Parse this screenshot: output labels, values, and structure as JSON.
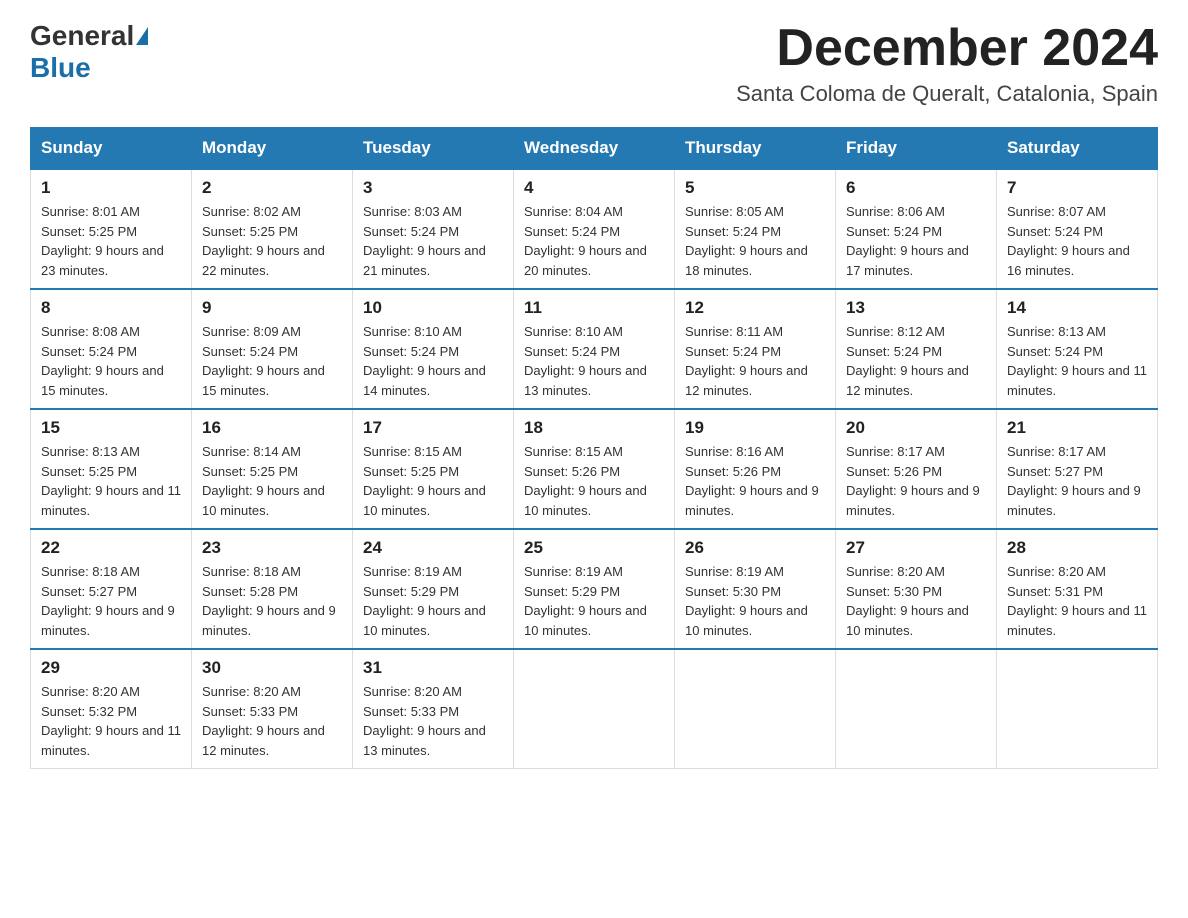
{
  "logo": {
    "general": "General",
    "blue": "Blue"
  },
  "title": {
    "month": "December 2024",
    "location": "Santa Coloma de Queralt, Catalonia, Spain"
  },
  "days_of_week": [
    "Sunday",
    "Monday",
    "Tuesday",
    "Wednesday",
    "Thursday",
    "Friday",
    "Saturday"
  ],
  "weeks": [
    [
      {
        "day": 1,
        "sunrise": "8:01 AM",
        "sunset": "5:25 PM",
        "daylight": "9 hours and 23 minutes."
      },
      {
        "day": 2,
        "sunrise": "8:02 AM",
        "sunset": "5:25 PM",
        "daylight": "9 hours and 22 minutes."
      },
      {
        "day": 3,
        "sunrise": "8:03 AM",
        "sunset": "5:24 PM",
        "daylight": "9 hours and 21 minutes."
      },
      {
        "day": 4,
        "sunrise": "8:04 AM",
        "sunset": "5:24 PM",
        "daylight": "9 hours and 20 minutes."
      },
      {
        "day": 5,
        "sunrise": "8:05 AM",
        "sunset": "5:24 PM",
        "daylight": "9 hours and 18 minutes."
      },
      {
        "day": 6,
        "sunrise": "8:06 AM",
        "sunset": "5:24 PM",
        "daylight": "9 hours and 17 minutes."
      },
      {
        "day": 7,
        "sunrise": "8:07 AM",
        "sunset": "5:24 PM",
        "daylight": "9 hours and 16 minutes."
      }
    ],
    [
      {
        "day": 8,
        "sunrise": "8:08 AM",
        "sunset": "5:24 PM",
        "daylight": "9 hours and 15 minutes."
      },
      {
        "day": 9,
        "sunrise": "8:09 AM",
        "sunset": "5:24 PM",
        "daylight": "9 hours and 15 minutes."
      },
      {
        "day": 10,
        "sunrise": "8:10 AM",
        "sunset": "5:24 PM",
        "daylight": "9 hours and 14 minutes."
      },
      {
        "day": 11,
        "sunrise": "8:10 AM",
        "sunset": "5:24 PM",
        "daylight": "9 hours and 13 minutes."
      },
      {
        "day": 12,
        "sunrise": "8:11 AM",
        "sunset": "5:24 PM",
        "daylight": "9 hours and 12 minutes."
      },
      {
        "day": 13,
        "sunrise": "8:12 AM",
        "sunset": "5:24 PM",
        "daylight": "9 hours and 12 minutes."
      },
      {
        "day": 14,
        "sunrise": "8:13 AM",
        "sunset": "5:24 PM",
        "daylight": "9 hours and 11 minutes."
      }
    ],
    [
      {
        "day": 15,
        "sunrise": "8:13 AM",
        "sunset": "5:25 PM",
        "daylight": "9 hours and 11 minutes."
      },
      {
        "day": 16,
        "sunrise": "8:14 AM",
        "sunset": "5:25 PM",
        "daylight": "9 hours and 10 minutes."
      },
      {
        "day": 17,
        "sunrise": "8:15 AM",
        "sunset": "5:25 PM",
        "daylight": "9 hours and 10 minutes."
      },
      {
        "day": 18,
        "sunrise": "8:15 AM",
        "sunset": "5:26 PM",
        "daylight": "9 hours and 10 minutes."
      },
      {
        "day": 19,
        "sunrise": "8:16 AM",
        "sunset": "5:26 PM",
        "daylight": "9 hours and 9 minutes."
      },
      {
        "day": 20,
        "sunrise": "8:17 AM",
        "sunset": "5:26 PM",
        "daylight": "9 hours and 9 minutes."
      },
      {
        "day": 21,
        "sunrise": "8:17 AM",
        "sunset": "5:27 PM",
        "daylight": "9 hours and 9 minutes."
      }
    ],
    [
      {
        "day": 22,
        "sunrise": "8:18 AM",
        "sunset": "5:27 PM",
        "daylight": "9 hours and 9 minutes."
      },
      {
        "day": 23,
        "sunrise": "8:18 AM",
        "sunset": "5:28 PM",
        "daylight": "9 hours and 9 minutes."
      },
      {
        "day": 24,
        "sunrise": "8:19 AM",
        "sunset": "5:29 PM",
        "daylight": "9 hours and 10 minutes."
      },
      {
        "day": 25,
        "sunrise": "8:19 AM",
        "sunset": "5:29 PM",
        "daylight": "9 hours and 10 minutes."
      },
      {
        "day": 26,
        "sunrise": "8:19 AM",
        "sunset": "5:30 PM",
        "daylight": "9 hours and 10 minutes."
      },
      {
        "day": 27,
        "sunrise": "8:20 AM",
        "sunset": "5:30 PM",
        "daylight": "9 hours and 10 minutes."
      },
      {
        "day": 28,
        "sunrise": "8:20 AM",
        "sunset": "5:31 PM",
        "daylight": "9 hours and 11 minutes."
      }
    ],
    [
      {
        "day": 29,
        "sunrise": "8:20 AM",
        "sunset": "5:32 PM",
        "daylight": "9 hours and 11 minutes."
      },
      {
        "day": 30,
        "sunrise": "8:20 AM",
        "sunset": "5:33 PM",
        "daylight": "9 hours and 12 minutes."
      },
      {
        "day": 31,
        "sunrise": "8:20 AM",
        "sunset": "5:33 PM",
        "daylight": "9 hours and 13 minutes."
      },
      null,
      null,
      null,
      null
    ]
  ]
}
